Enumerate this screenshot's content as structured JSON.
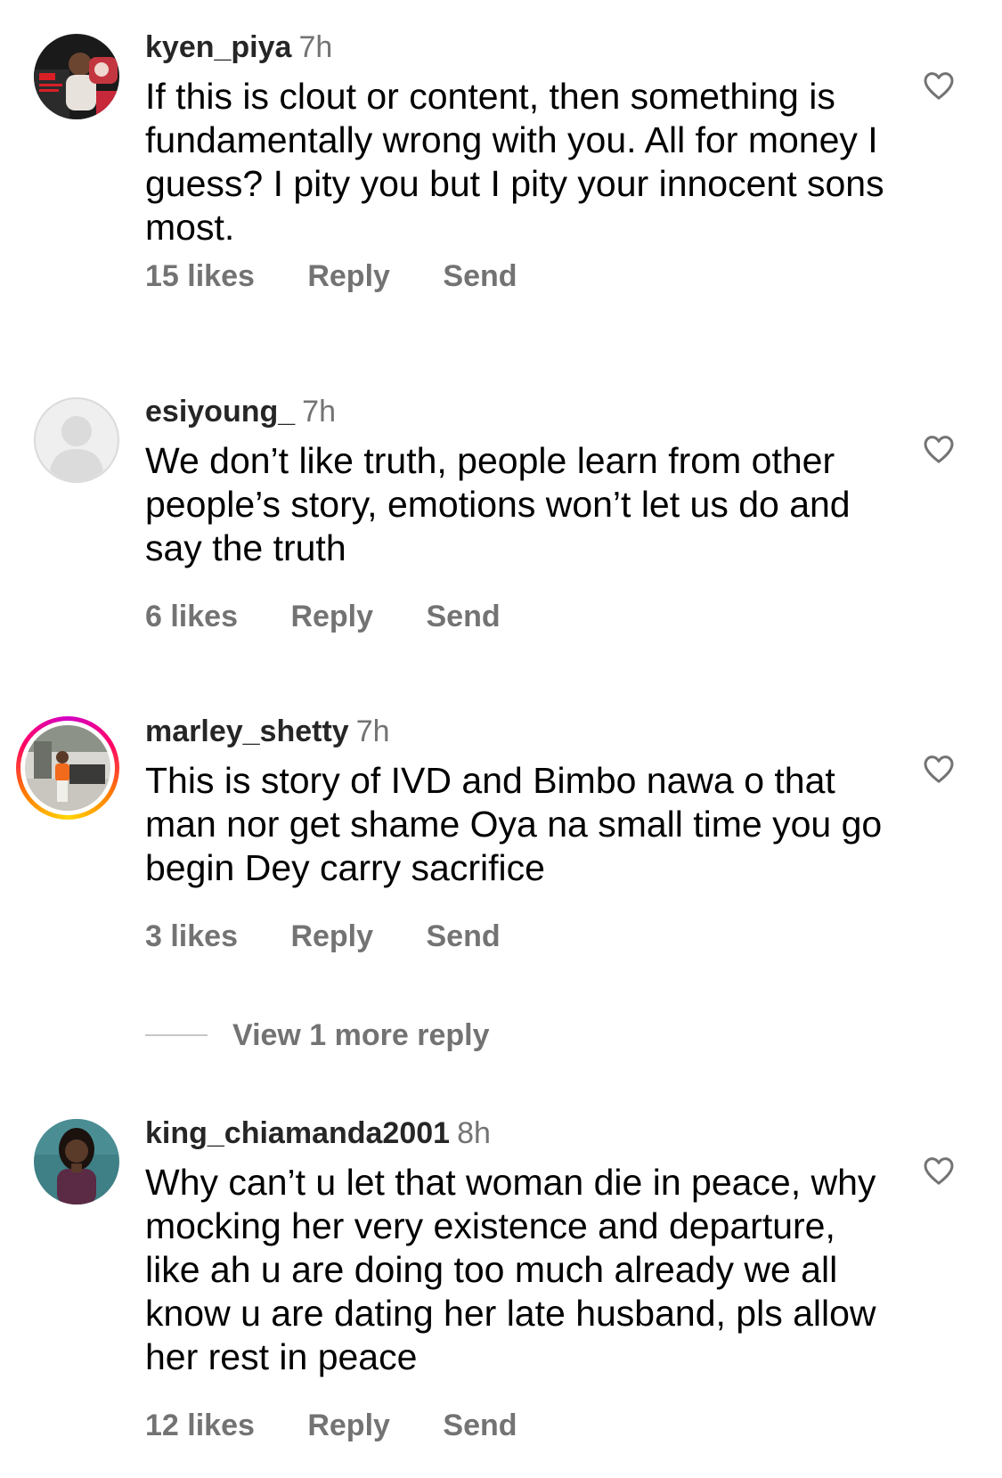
{
  "comments": [
    {
      "username": "kyen_piya",
      "time": "7h",
      "text": "If this is clout or content, then something is fundamentally wrong with you. All for money I guess? I pity you but I pity your innocent sons most.",
      "likes": "15 likes",
      "reply": "Reply",
      "send": "Send",
      "avatar": "profile-photo",
      "like_icon": "heart-outline-icon"
    },
    {
      "username": "esiyoung_",
      "time": "7h",
      "text": "We don’t like truth, people learn from other people’s story, emotions won’t let us do and say the truth",
      "likes": "6 likes",
      "reply": "Reply",
      "send": "Send",
      "avatar": "default-avatar",
      "like_icon": "heart-outline-icon"
    },
    {
      "username": "marley_shetty",
      "time": "7h",
      "text": "This is story of IVD and Bimbo nawa o that man nor get shame Oya na small time you go begin Dey carry sacrifice",
      "likes": "3 likes",
      "reply": "Reply",
      "send": "Send",
      "avatar": "profile-photo-with-story-ring",
      "like_icon": "heart-outline-icon"
    },
    {
      "username": "king_chiamanda2001",
      "time": "8h",
      "text": "Why can’t u let that woman die in peace, why mocking her very existence and departure, like ah u are doing too much already we all know u are dating her late husband, pls allow her rest in peace",
      "likes": "12 likes",
      "reply": "Reply",
      "send": "Send",
      "avatar": "profile-photo",
      "like_icon": "heart-outline-icon"
    }
  ],
  "view_more_replies": "View 1 more reply",
  "colors": {
    "username": "#262626",
    "secondary_text": "#737373",
    "body_text": "#000000",
    "story_ring": [
      "#d300c5",
      "#ff0069",
      "#ff7a00",
      "#ffd600"
    ]
  }
}
